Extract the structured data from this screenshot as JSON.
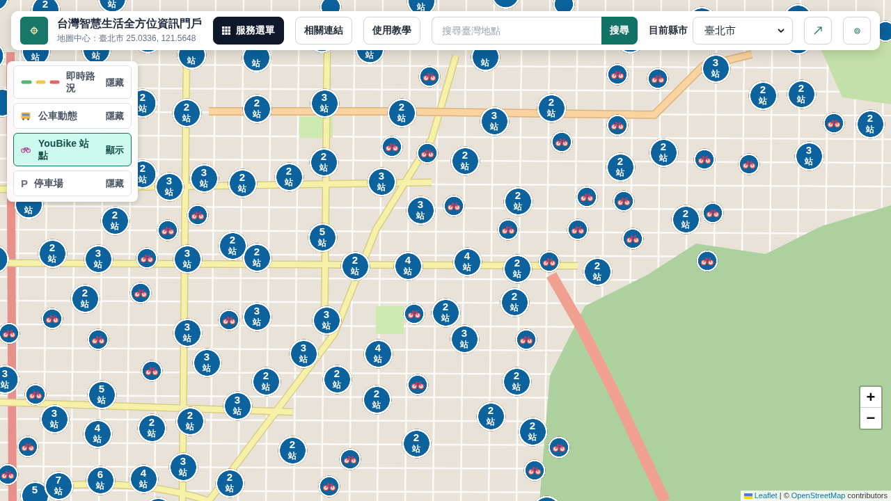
{
  "header": {
    "title": "台灣智慧生活全方位資訊門戶",
    "subtitle": "地圖中心：臺北市 25.0336, 121.5648",
    "buttons": [
      {
        "kind": "primary",
        "label": "服務選單"
      },
      {
        "kind": "outline",
        "label": "相關連結"
      },
      {
        "kind": "outline",
        "label": "使用教學"
      }
    ],
    "search": {
      "placeholder": "搜尋臺灣地點",
      "button": "搜尋"
    },
    "city": {
      "label": "目前縣市",
      "value": "臺北市"
    },
    "icon_buttons": [
      {
        "kind": "arrow"
      },
      {
        "kind": "target"
      }
    ]
  },
  "layers": [
    {
      "kind": "traffic",
      "label": "即時路況",
      "status": "隱藏",
      "active": false
    },
    {
      "kind": "bus",
      "label": "公車動態",
      "status": "隱藏",
      "active": false
    },
    {
      "kind": "bike",
      "label": "YouBike 站點",
      "status": "顯示",
      "active": true
    },
    {
      "kind": "parking",
      "glyph": "P",
      "label": "停車場",
      "status": "隱藏",
      "active": false
    }
  ],
  "markers": [
    {
      "kind": "cluster"
    },
    {
      "kind": "cluster",
      "count": "2"
    },
    {
      "kind": "cluster",
      "unit": "站"
    },
    {
      "kind": "bike"
    },
    {
      "kind": "cluster",
      "unit": "站"
    },
    {
      "kind": "cluster"
    },
    {
      "kind": "bike"
    },
    {
      "kind": "cluster"
    },
    {
      "kind": "cluster"
    },
    {
      "kind": "bike"
    },
    {
      "kind": "cluster"
    },
    {
      "kind": "cluster",
      "unit": "站"
    },
    {
      "kind": "cluster",
      "unit": "站"
    },
    {
      "kind": "cluster"
    },
    {
      "kind": "cluster",
      "unit": "站"
    },
    {
      "kind": "cluster",
      "unit": "站"
    },
    {
      "kind": "cluster"
    },
    {
      "kind": "cluster",
      "unit": "站"
    },
    {
      "kind": "bike"
    },
    {
      "kind": "cluster",
      "unit": "站"
    },
    {
      "kind": "bike"
    },
    {
      "kind": "cluster"
    },
    {
      "kind": "bike"
    },
    {
      "kind": "cluster",
      "count": "3",
      "unit": "站"
    },
    {
      "kind": "cluster"
    },
    {
      "kind": "cluster"
    },
    {
      "kind": "cluster",
      "count": "2",
      "unit": "站"
    },
    {
      "kind": "cluster",
      "count": "2",
      "unit": "站"
    },
    {
      "kind": "cluster",
      "count": "2",
      "unit": "站"
    },
    {
      "kind": "cluster",
      "count": "3",
      "unit": "站"
    },
    {
      "kind": "cluster",
      "count": "2",
      "unit": "站"
    },
    {
      "kind": "cluster",
      "count": "3",
      "unit": "站"
    },
    {
      "kind": "cluster",
      "count": "2",
      "unit": "站"
    },
    {
      "kind": "cluster",
      "count": "2",
      "unit": "站"
    },
    {
      "kind": "cluster",
      "count": "2",
      "unit": "站"
    },
    {
      "kind": "bike"
    },
    {
      "kind": "bike"
    },
    {
      "kind": "cluster",
      "count": "2",
      "unit": "站"
    },
    {
      "kind": "cluster",
      "count": "2",
      "unit": "站"
    },
    {
      "kind": "cluster",
      "count": "3",
      "unit": "站"
    },
    {
      "kind": "cluster",
      "count": "3",
      "unit": "站"
    },
    {
      "kind": "cluster",
      "count": "2",
      "unit": "站"
    },
    {
      "kind": "cluster",
      "count": "2",
      "unit": "站"
    },
    {
      "kind": "cluster",
      "count": "2",
      "unit": "站"
    },
    {
      "kind": "bike"
    },
    {
      "kind": "bike"
    },
    {
      "kind": "bike"
    },
    {
      "kind": "cluster",
      "count": "2",
      "unit": "站"
    },
    {
      "kind": "cluster",
      "count": "3",
      "unit": "站"
    },
    {
      "kind": "cluster",
      "count": "2",
      "unit": "站"
    },
    {
      "kind": "cluster",
      "count": "2",
      "unit": "站"
    },
    {
      "kind": "bike"
    },
    {
      "kind": "bike"
    },
    {
      "kind": "cluster",
      "count": "3",
      "unit": "站"
    },
    {
      "kind": "cluster",
      "unit": "站"
    },
    {
      "kind": "cluster",
      "count": "2",
      "unit": "站"
    },
    {
      "kind": "bike"
    },
    {
      "kind": "cluster",
      "count": "3",
      "unit": "站"
    },
    {
      "kind": "bike"
    },
    {
      "kind": "cluster",
      "count": "2",
      "unit": "站"
    },
    {
      "kind": "bike"
    },
    {
      "kind": "bike"
    },
    {
      "kind": "bike"
    },
    {
      "kind": "cluster"
    },
    {
      "kind": "cluster",
      "count": "2",
      "unit": "站"
    },
    {
      "kind": "cluster",
      "count": "3",
      "unit": "站"
    },
    {
      "kind": "bike"
    },
    {
      "kind": "cluster",
      "count": "3",
      "unit": "站"
    },
    {
      "kind": "cluster",
      "count": "2",
      "unit": "站"
    },
    {
      "kind": "cluster",
      "count": "5",
      "unit": "站"
    },
    {
      "kind": "bike"
    },
    {
      "kind": "bike"
    },
    {
      "kind": "cluster",
      "count": "2",
      "unit": "站"
    },
    {
      "kind": "bike"
    },
    {
      "kind": "bike"
    },
    {
      "kind": "cluster",
      "count": "2",
      "unit": "站"
    },
    {
      "kind": "cluster",
      "count": "2",
      "unit": "站"
    },
    {
      "kind": "cluster",
      "count": "4",
      "unit": "站"
    },
    {
      "kind": "cluster",
      "count": "4",
      "unit": "站"
    },
    {
      "kind": "cluster",
      "count": "2",
      "unit": "站"
    },
    {
      "kind": "bike"
    },
    {
      "kind": "cluster",
      "count": "2",
      "unit": "站"
    },
    {
      "kind": "bike"
    },
    {
      "kind": "cluster",
      "count": "2",
      "unit": "站"
    },
    {
      "kind": "bike"
    },
    {
      "kind": "bike"
    },
    {
      "kind": "bike"
    },
    {
      "kind": "bike"
    },
    {
      "kind": "cluster",
      "count": "3",
      "unit": "站"
    },
    {
      "kind": "bike"
    },
    {
      "kind": "cluster",
      "count": "3",
      "unit": "站"
    },
    {
      "kind": "cluster",
      "count": "3",
      "unit": "站"
    },
    {
      "kind": "bike"
    },
    {
      "kind": "cluster",
      "count": "2",
      "unit": "站"
    },
    {
      "kind": "cluster",
      "count": "2",
      "unit": "站"
    },
    {
      "kind": "cluster",
      "count": "3",
      "unit": "站"
    },
    {
      "kind": "bike"
    },
    {
      "kind": "cluster",
      "count": "3",
      "unit": "站"
    },
    {
      "kind": "cluster",
      "count": "3",
      "unit": "站"
    },
    {
      "kind": "cluster",
      "count": "4",
      "unit": "站"
    },
    {
      "kind": "cluster",
      "count": "3",
      "unit": "站"
    },
    {
      "kind": "bike"
    },
    {
      "kind": "bike"
    },
    {
      "kind": "cluster",
      "count": "5",
      "unit": "站"
    },
    {
      "kind": "cluster",
      "count": "2",
      "unit": "站"
    },
    {
      "kind": "cluster",
      "count": "2",
      "unit": "站"
    },
    {
      "kind": "cluster",
      "count": "3",
      "unit": "站"
    },
    {
      "kind": "cluster",
      "count": "4",
      "unit": "站"
    },
    {
      "kind": "cluster",
      "count": "2",
      "unit": "站"
    },
    {
      "kind": "cluster",
      "count": "2",
      "unit": "站"
    },
    {
      "kind": "cluster",
      "count": "3",
      "unit": "站"
    },
    {
      "kind": "cluster",
      "count": "2",
      "unit": "站"
    },
    {
      "kind": "bike"
    },
    {
      "kind": "cluster",
      "count": "2",
      "unit": "站"
    },
    {
      "kind": "cluster",
      "count": "2",
      "unit": "站"
    },
    {
      "kind": "bike"
    },
    {
      "kind": "bike"
    },
    {
      "kind": "cluster",
      "count": "5"
    },
    {
      "kind": "cluster",
      "count": "7",
      "unit": "站"
    },
    {
      "kind": "cluster",
      "count": "6",
      "unit": "站"
    },
    {
      "kind": "cluster",
      "count": "4",
      "unit": "站"
    },
    {
      "kind": "cluster",
      "count": "3",
      "unit": "站"
    },
    {
      "kind": "cluster",
      "count": "2",
      "unit": "站"
    },
    {
      "kind": "bike"
    },
    {
      "kind": "cluster",
      "count": "2",
      "unit": "站"
    },
    {
      "kind": "cluster",
      "count": "2",
      "unit": "站"
    },
    {
      "kind": "bike"
    },
    {
      "kind": "cluster",
      "count": "2",
      "unit": "站"
    },
    {
      "kind": "bike"
    },
    {
      "kind": "bike"
    },
    {
      "kind": "cluster"
    },
    {
      "kind": "cluster"
    }
  ],
  "zoom": {
    "zoom_in": "+",
    "zoom_out": "−"
  },
  "attribution": {
    "leaflet_link": "Leaflet",
    "separator": "|",
    "copyright": "©",
    "osm_link": "OpenStreetMap",
    "suffix": "contributors"
  }
}
